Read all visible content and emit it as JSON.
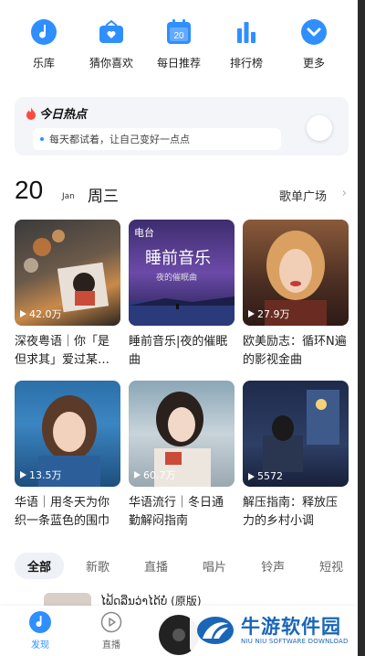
{
  "colors": {
    "accent": "#2f8fff",
    "watermark_blue": "#1966b8"
  },
  "quick_nav": [
    {
      "label": "乐库",
      "icon": "music-note-icon"
    },
    {
      "label": "猜你喜欢",
      "icon": "radio-icon"
    },
    {
      "label": "每日推荐",
      "icon": "calendar-icon",
      "icon_text": "20"
    },
    {
      "label": "排行榜",
      "icon": "ranking-bars-icon"
    },
    {
      "label": "更多",
      "icon": "chevron-down-circle-icon"
    }
  ],
  "hot": {
    "title": "今日热点",
    "subtitle": "每天都试着，让自己变好一点点"
  },
  "date": {
    "day": "20",
    "month": "Jan",
    "weekday": "周三"
  },
  "plaza_link": "歌单广场",
  "playlists": [
    {
      "title": "深夜粤语｜你「是但求其」爱过某…",
      "play_count": "42.0万"
    },
    {
      "title": "睡前音乐|夜的催眠曲",
      "tag": "电台",
      "cover_title": "睡前音乐",
      "cover_sub": "夜的催眠曲"
    },
    {
      "title": "欧美励志：循环N遍的影视金曲",
      "play_count": "27.9万"
    },
    {
      "title": "华语｜用冬天为你织一条蓝色的围巾",
      "play_count": "13.5万"
    },
    {
      "title": "华语流行｜冬日通勤解闷指南",
      "play_count": "60.7万"
    },
    {
      "title": "解压指南：释放压力的乡村小调",
      "play_count": "5572"
    }
  ],
  "tabs": [
    "全部",
    "新歌",
    "直播",
    "唱片",
    "铃声",
    "短视"
  ],
  "peek_item": "ໄຟ້ດລືນວ່າໄດ້ບໍ່ (原版)",
  "bottom_nav": [
    {
      "label": "发现",
      "active": true
    },
    {
      "label": "直播",
      "active": false
    }
  ],
  "watermark": {
    "title": "牛游软件园",
    "subtitle": "NIU NIU SOFTWARE DOWNLOAD"
  }
}
